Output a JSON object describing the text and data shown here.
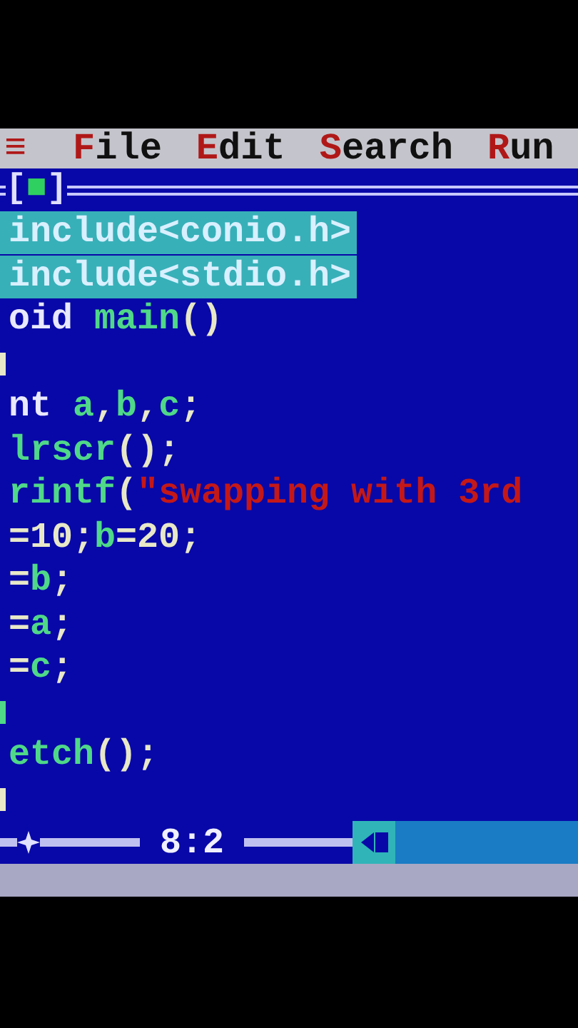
{
  "menu_bar": {
    "system_menu": "≡",
    "items": [
      {
        "label": "File"
      },
      {
        "label": "Edit"
      },
      {
        "label": "Search"
      },
      {
        "label": "Run"
      }
    ]
  },
  "window": {
    "close_box": "[■]"
  },
  "editor": {
    "lines": [
      {
        "selected": true,
        "tokens": [
          {
            "kind": "directive",
            "text": "include<conio.h>"
          }
        ]
      },
      {
        "selected": true,
        "tokens": [
          {
            "kind": "directive",
            "text": "include<stdio.h>"
          }
        ]
      },
      {
        "selected": false,
        "tokens": [
          {
            "kind": "keyword",
            "text": "oid "
          },
          {
            "kind": "ident",
            "text": "main"
          },
          {
            "kind": "punct",
            "text": "()"
          }
        ]
      },
      {
        "kind": "clipped",
        "color": "#e8e8c8"
      },
      {
        "selected": false,
        "tokens": [
          {
            "kind": "keyword",
            "text": "nt "
          },
          {
            "kind": "ident",
            "text": "a"
          },
          {
            "kind": "punct",
            "text": ","
          },
          {
            "kind": "ident",
            "text": "b"
          },
          {
            "kind": "punct",
            "text": ","
          },
          {
            "kind": "ident",
            "text": "c"
          },
          {
            "kind": "punct",
            "text": ";"
          }
        ]
      },
      {
        "selected": false,
        "tokens": [
          {
            "kind": "ident",
            "text": "lrscr"
          },
          {
            "kind": "punct",
            "text": "();"
          }
        ]
      },
      {
        "selected": false,
        "tokens": [
          {
            "kind": "ident",
            "text": "rintf"
          },
          {
            "kind": "punct",
            "text": "("
          },
          {
            "kind": "string",
            "text": "\"swapping with 3rd"
          }
        ]
      },
      {
        "selected": false,
        "tokens": [
          {
            "kind": "punct",
            "text": "=10;"
          },
          {
            "kind": "ident",
            "text": "b"
          },
          {
            "kind": "punct",
            "text": "=20;"
          }
        ]
      },
      {
        "selected": false,
        "tokens": [
          {
            "kind": "punct",
            "text": "="
          },
          {
            "kind": "ident",
            "text": "b"
          },
          {
            "kind": "punct",
            "text": ";"
          }
        ]
      },
      {
        "selected": false,
        "tokens": [
          {
            "kind": "punct",
            "text": "="
          },
          {
            "kind": "ident",
            "text": "a"
          },
          {
            "kind": "punct",
            "text": ";"
          }
        ]
      },
      {
        "selected": false,
        "tokens": [
          {
            "kind": "punct",
            "text": "="
          },
          {
            "kind": "ident",
            "text": "c"
          },
          {
            "kind": "punct",
            "text": ";"
          }
        ]
      },
      {
        "kind": "clipped",
        "color": "#4fd888"
      },
      {
        "selected": false,
        "tokens": [
          {
            "kind": "ident",
            "text": "etch"
          },
          {
            "kind": "punct",
            "text": "();"
          }
        ]
      },
      {
        "kind": "clipped",
        "color": "#e8e8c8"
      }
    ]
  },
  "status_bar": {
    "position": "8:2"
  }
}
